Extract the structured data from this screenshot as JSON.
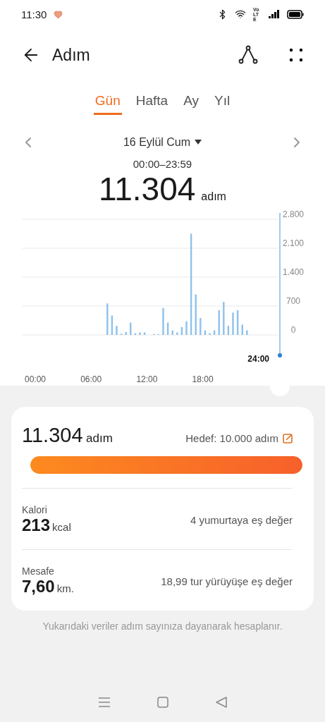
{
  "status_bar": {
    "time": "11:30",
    "network": "Vo LTE"
  },
  "header": {
    "title": "Adım"
  },
  "tabs": [
    {
      "label": "Gün",
      "selected": true
    },
    {
      "label": "Hafta",
      "selected": false
    },
    {
      "label": "Ay",
      "selected": false
    },
    {
      "label": "Yıl",
      "selected": false
    }
  ],
  "date_nav": {
    "date": "16 Eylül Cum",
    "time_range": "00:00–23:59"
  },
  "total": {
    "value": "11.304",
    "unit": "adım"
  },
  "chart": {
    "cursor_label": "24:00",
    "chart_data": {
      "type": "bar",
      "x": [
        7.75,
        8.25,
        8.75,
        9.25,
        9.75,
        10.25,
        10.75,
        11.25,
        11.75,
        12.75,
        13.25,
        13.75,
        14.25,
        14.75,
        15.25,
        15.75,
        16.25,
        16.75,
        17.25,
        17.75,
        18.25,
        18.75,
        19.25,
        19.75,
        20.25,
        20.75,
        21.25,
        21.75,
        22.25,
        22.75
      ],
      "series": [
        {
          "color": "#8ec1ec",
          "values": [
            760,
            470,
            220,
            30,
            70,
            300,
            40,
            60,
            60,
            20,
            20,
            650,
            300,
            110,
            60,
            190,
            330,
            2450,
            980,
            410,
            110,
            40,
            110,
            600,
            800,
            220,
            540,
            600,
            250,
            110
          ]
        }
      ],
      "grid": true,
      "xlim": [
        -1.4,
        26.1
      ],
      "ylim": [
        0,
        2800
      ],
      "xticks": [
        {
          "value": 0,
          "label": "00:00"
        },
        {
          "value": 6,
          "label": "06:00"
        },
        {
          "value": 12,
          "label": "12:00"
        },
        {
          "value": 18,
          "label": "18:00"
        }
      ],
      "yticks": [
        {
          "value": 0,
          "label": "0"
        },
        {
          "value": 700,
          "label": "700"
        },
        {
          "value": 1400,
          "label": "1.400"
        },
        {
          "value": 2100,
          "label": "2.100"
        },
        {
          "value": 2800,
          "label": "2.800"
        }
      ]
    }
  },
  "summary": {
    "steps": {
      "value": "11.304",
      "unit": "adım"
    },
    "goal": "Hedef: 10.000 adım",
    "progress": {
      "level": 1
    },
    "metrics": [
      {
        "label": "Kalori",
        "value": "213",
        "unit": "kcal",
        "equivalent": "4 yumurtaya eş değer"
      },
      {
        "label": "Mesafe",
        "value": "7,60",
        "unit": "km.",
        "equivalent": "18,99 tur yürüyüşe eş değer"
      }
    ]
  },
  "footnote": "Yukarıdaki veriler adım sayınıza dayanarak hesaplanır."
}
